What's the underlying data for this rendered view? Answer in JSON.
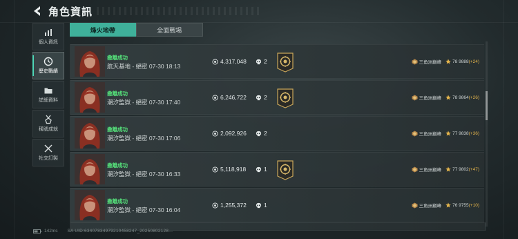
{
  "header": {
    "title": "角色資訊"
  },
  "sidebar": {
    "items": [
      {
        "label": "個人資訊",
        "icon": "bar-chart-icon"
      },
      {
        "label": "歷史戰績",
        "icon": "clock-icon"
      },
      {
        "label": "詳細資料",
        "icon": "folder-icon"
      },
      {
        "label": "稱號成就",
        "icon": "medal-icon"
      },
      {
        "label": "社交訂製",
        "icon": "tools-icon"
      }
    ]
  },
  "tabs": [
    {
      "label": "烽火地帶"
    },
    {
      "label": "全面戰場"
    }
  ],
  "records": [
    {
      "status": "撤離成功",
      "detail": "航天基地 - 絕密 07-30 18:13",
      "assets": "4,317,048",
      "kills": "2",
      "badge": true,
      "rank_name": "三角洲巔峰",
      "rank_level": "78",
      "rank_points": "9888",
      "rank_delta": "(+24)"
    },
    {
      "status": "撤離成功",
      "detail": "潮汐監獄 - 絕密 07-30 17:40",
      "assets": "6,246,722",
      "kills": "2",
      "badge": true,
      "rank_name": "三角洲巔峰",
      "rank_level": "78",
      "rank_points": "9864",
      "rank_delta": "(+26)"
    },
    {
      "status": "撤離成功",
      "detail": "潮汐監獄 - 絕密 07-30 17:06",
      "assets": "2,092,926",
      "kills": "2",
      "badge": false,
      "rank_name": "三角洲巔峰",
      "rank_level": "77",
      "rank_points": "9838",
      "rank_delta": "(+36)"
    },
    {
      "status": "撤離成功",
      "detail": "潮汐監獄 - 絕密 07-30 16:33",
      "assets": "5,118,918",
      "kills": "1",
      "badge": true,
      "rank_name": "三角洲巔峰",
      "rank_level": "77",
      "rank_points": "9802",
      "rank_delta": "(+47)"
    },
    {
      "status": "撤離成功",
      "detail": "潮汐監獄 - 絕密 07-30 16:04",
      "assets": "1,255,372",
      "kills": "1",
      "badge": false,
      "rank_name": "三角洲巔峰",
      "rank_level": "76",
      "rank_points": "9755",
      "rank_delta": "(+10)"
    }
  ],
  "footer": {
    "latency": "142ms",
    "uid": "SA UID:63407834979210458247_20250802128..."
  },
  "colors": {
    "accent": "#3fb09a",
    "success": "#55e07a",
    "delta": "#e6b64c"
  }
}
